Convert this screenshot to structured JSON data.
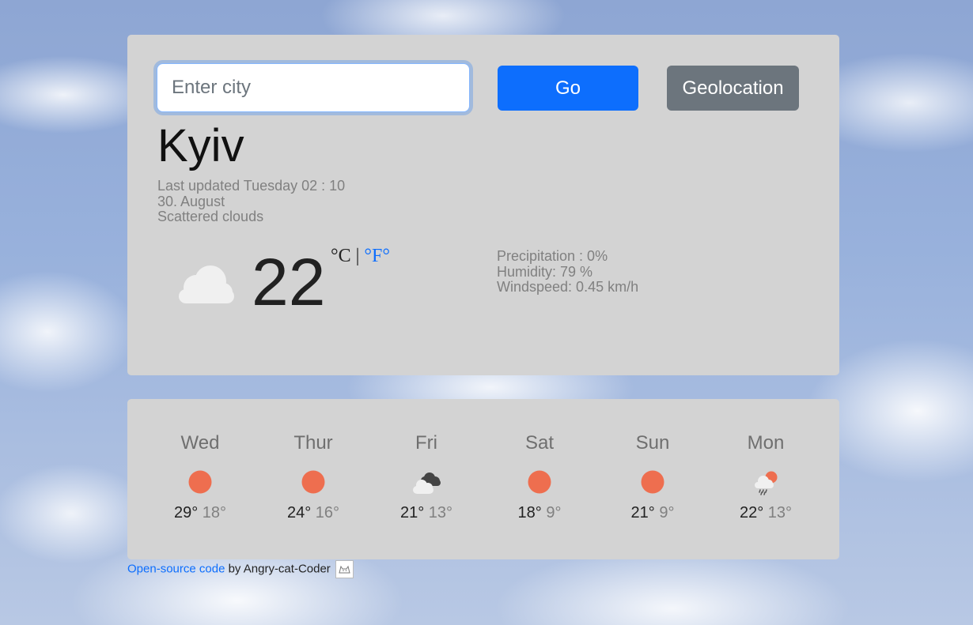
{
  "search": {
    "placeholder": "Enter city",
    "value": ""
  },
  "buttons": {
    "go_label": "Go",
    "geo_label": "Geolocation"
  },
  "current": {
    "city": "Kyiv",
    "last_updated": "Last updated Tuesday 02 : 10",
    "date": "30. August",
    "description": "Scattered clouds",
    "icon": "cloud-icon",
    "temperature": "22",
    "unit_c": "°C",
    "unit_sep": " | ",
    "unit_f": "°F°",
    "precipitation": "Precipitation : 0%",
    "humidity": "Humidity: 79 %",
    "windspeed": "Windspeed: 0.45 km/h"
  },
  "forecast": [
    {
      "day": "Wed",
      "icon": "sun-icon",
      "hi": "29°",
      "lo": "18°"
    },
    {
      "day": "Thur",
      "icon": "sun-icon",
      "hi": "24°",
      "lo": "16°"
    },
    {
      "day": "Fri",
      "icon": "dark-clouds-icon",
      "hi": "21°",
      "lo": "13°"
    },
    {
      "day": "Sat",
      "icon": "sun-icon",
      "hi": "18°",
      "lo": "9°"
    },
    {
      "day": "Sun",
      "icon": "sun-icon",
      "hi": "21°",
      "lo": "9°"
    },
    {
      "day": "Mon",
      "icon": "sun-rain-cloud-icon",
      "hi": "22°",
      "lo": "13°"
    }
  ],
  "footer": {
    "link": "Open-source code",
    "text": " by Angry-cat-Coder "
  },
  "colors": {
    "accent": "#0d6efd",
    "secondary": "#6c757d",
    "sun": "#ee6e4f",
    "card": "#d3d3d3"
  }
}
